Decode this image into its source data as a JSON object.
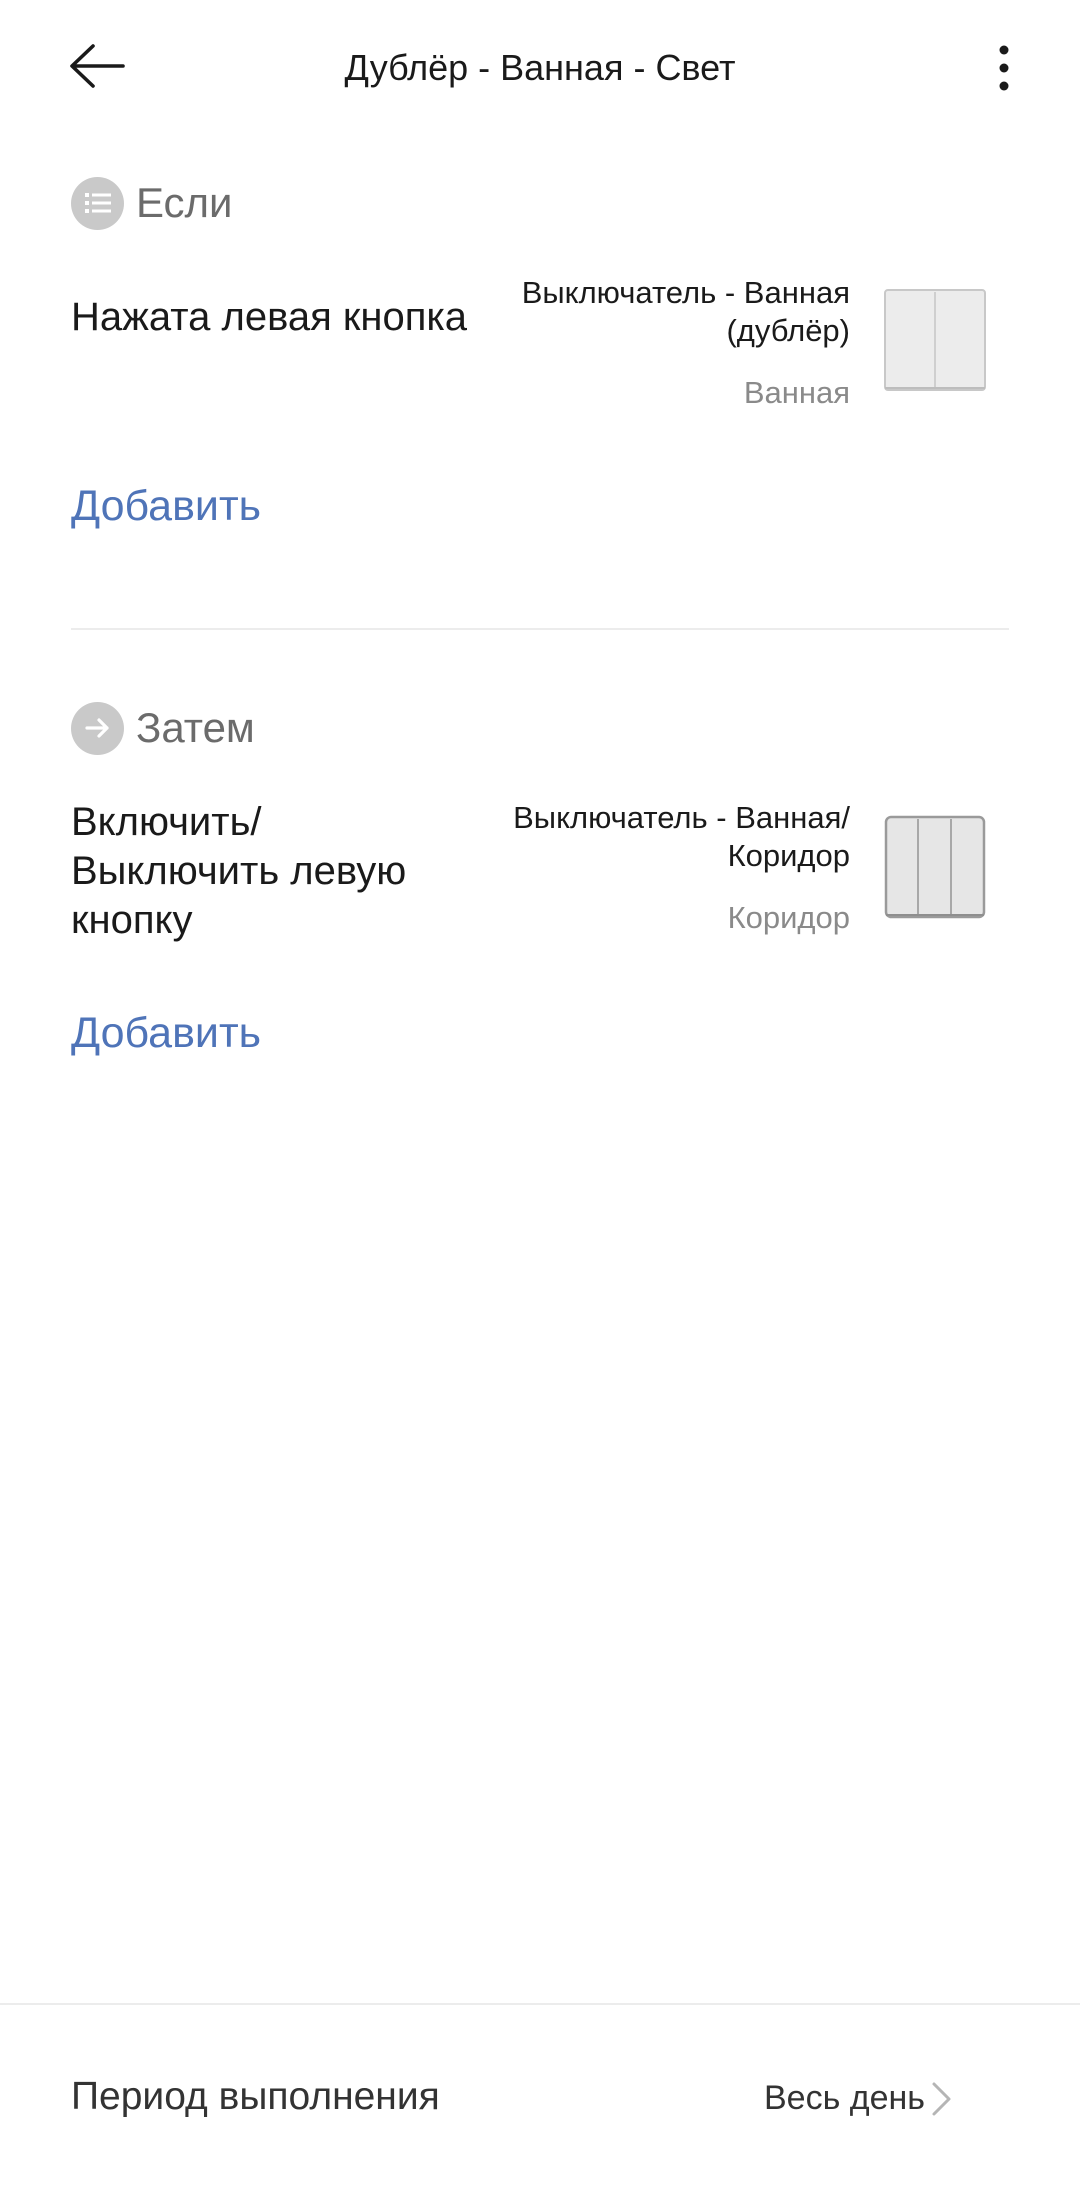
{
  "header": {
    "title": "Дублёр - Ванная - Свет",
    "back_icon": "back-arrow-icon",
    "menu_icon": "more-vertical-icon"
  },
  "if_section": {
    "label": "Если",
    "icon": "list-icon",
    "condition": {
      "text": "Нажата левая кнопка",
      "device_name": "Выключатель - Ванная (дублёр)",
      "room": "Ванная",
      "device_icon": "two-gang-switch-icon"
    },
    "add_label": "Добавить"
  },
  "then_section": {
    "label": "Затем",
    "icon": "arrow-right-icon",
    "action": {
      "text": "Включить/ Выключить левую кнопку",
      "device_name": "Выключатель - Ванная/ Коридор",
      "room": "Коридор",
      "device_icon": "three-gang-switch-icon"
    },
    "add_label": "Добавить"
  },
  "footer": {
    "label": "Период выполнения",
    "value": "Весь день",
    "chevron_icon": "chevron-right-icon"
  },
  "colors": {
    "accent": "#4f74b8",
    "section_icon_bg": "#c9c9c9",
    "secondary_text": "#8a8a8a"
  }
}
